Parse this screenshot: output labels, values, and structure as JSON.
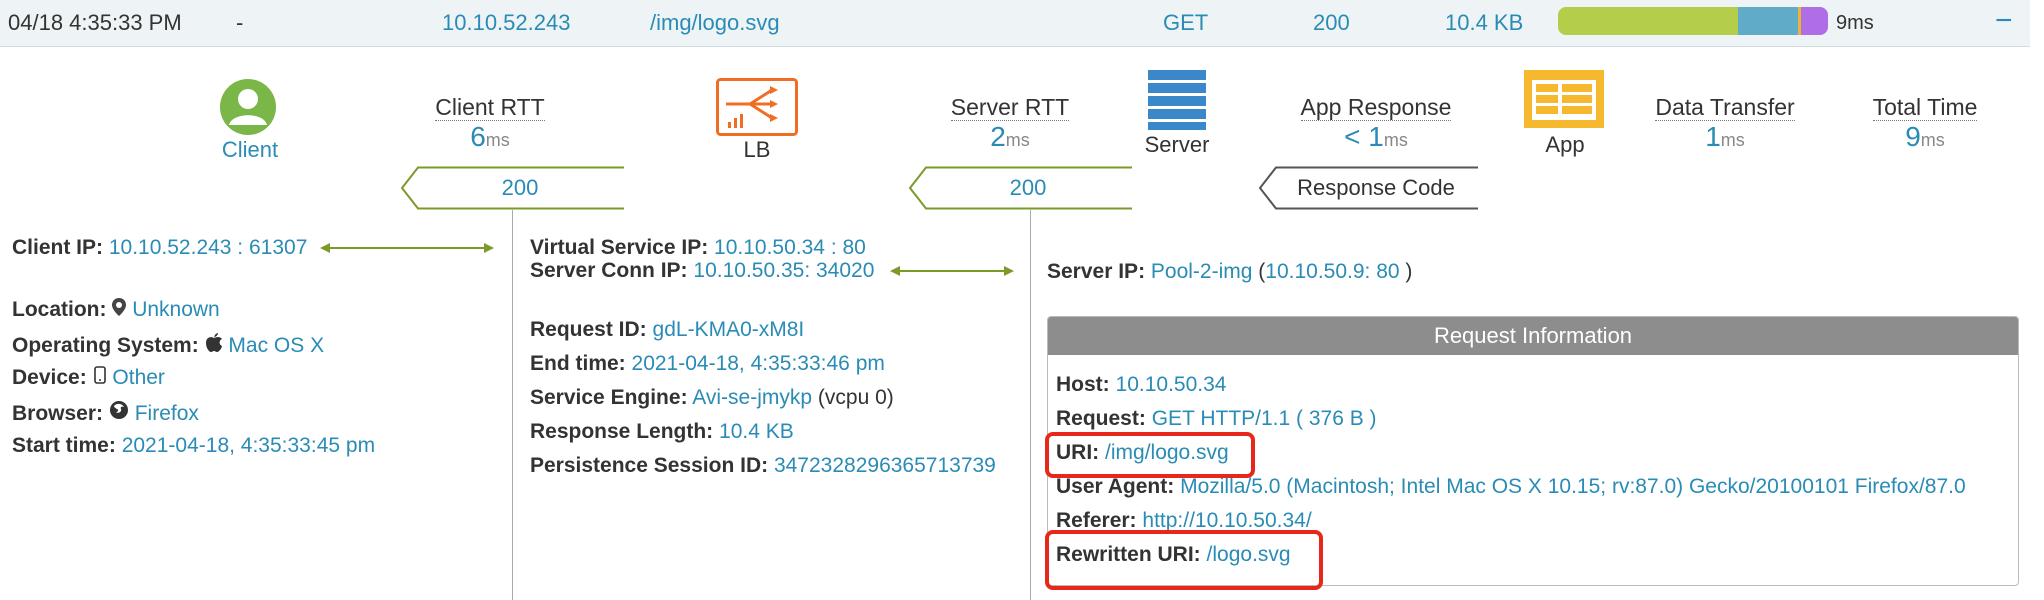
{
  "log_row": {
    "timestamp": "04/18 4:35:33 PM",
    "dash": "-",
    "client_ip": "10.10.52.243",
    "uri": "/img/logo.svg",
    "method": "GET",
    "status": "200",
    "size": "10.4 KB",
    "total_time": "9ms",
    "collapse": "−"
  },
  "timing_bar_colors": [
    "#b4cd4a",
    "#5fabc8",
    "#e8b63a",
    "#b06ee6"
  ],
  "flow": {
    "client_label": "Client",
    "lb_label": "LB",
    "server_label": "Server",
    "app_label": "App",
    "client_rtt_label": "Client RTT",
    "client_rtt_value": "6",
    "server_rtt_label": "Server RTT",
    "server_rtt_value": "2",
    "app_response_label": "App Response",
    "app_response_value": "< 1",
    "data_transfer_label": "Data Transfer",
    "data_transfer_value": "1",
    "total_time_label": "Total Time",
    "total_time_value": "9",
    "unit": "ms",
    "code_client": "200",
    "code_lb": "200",
    "response_code_label": "Response Code"
  },
  "client_details": {
    "client_ip_label": "Client IP:",
    "client_ip_value": "10.10.52.243 : 61307",
    "location_label": "Location:",
    "location_value": "Unknown",
    "os_label": "Operating System:",
    "os_value": "Mac OS X",
    "device_label": "Device:",
    "device_value": "Other",
    "browser_label": "Browser:",
    "browser_value": "Firefox",
    "start_label": "Start time:",
    "start_value": "2021-04-18, 4:35:33:45 pm"
  },
  "lb_details": {
    "vs_ip_label": "Virtual Service IP:",
    "vs_ip_value": "10.10.50.34 : 80",
    "conn_ip_label": "Server Conn IP:",
    "conn_ip_value": "10.10.50.35: 34020",
    "req_id_label": "Request ID:",
    "req_id_value": "gdL-KMA0-xM8I",
    "end_label": "End time:",
    "end_value": "2021-04-18, 4:35:33:46 pm",
    "se_label": "Service Engine:",
    "se_value": "Avi-se-jmykp",
    "se_extra": "(vcpu 0)",
    "resp_len_label": "Response Length:",
    "resp_len_value": "10.4 KB",
    "persist_label": "Persistence Session ID:",
    "persist_value": "3472328296365713739"
  },
  "server_details": {
    "server_ip_label": "Server IP:",
    "server_ip_pool": "Pool-2-img",
    "server_ip_open": " (",
    "server_ip_addr": "10.10.50.9: 80",
    "server_ip_close": " )"
  },
  "request_info": {
    "title": "Request Information",
    "host_label": "Host:",
    "host_value": "10.10.50.34",
    "request_label": "Request:",
    "request_value": "GET HTTP/1.1 ( 376 B )",
    "uri_label": "URI:",
    "uri_value": "/img/logo.svg",
    "ua_label": "User Agent:",
    "ua_value": "Mozilla/5.0 (Macintosh; Intel Mac OS X 10.15; rv:87.0) Gecko/20100101 Firefox/87.0",
    "referer_label": "Referer:",
    "referer_value": "http://10.10.50.34/",
    "rewritten_label": "Rewritten URI:",
    "rewritten_value": "/logo.svg"
  }
}
